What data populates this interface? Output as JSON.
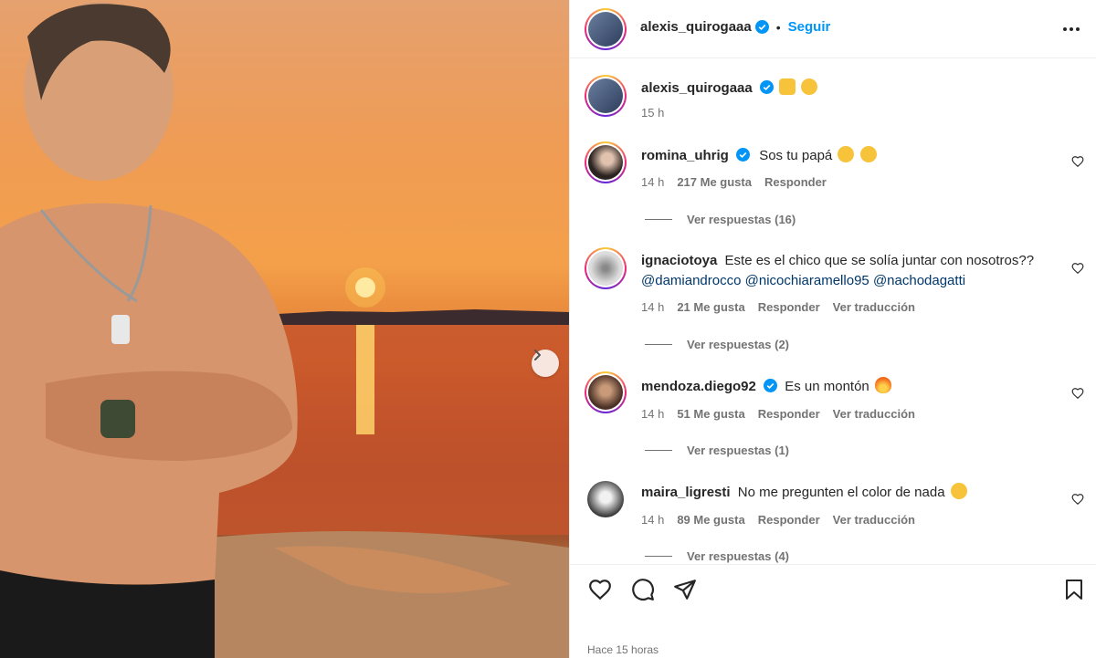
{
  "post": {
    "author": "alexis_quirogaaa",
    "follow_label": "Seguir",
    "caption_time": "15 h",
    "time_ago": "Hace 15 horas"
  },
  "comments": [
    {
      "user": "romina_uhrig",
      "verified": true,
      "text": "Sos tu papá",
      "time": "14 h",
      "likes": "217 Me gusta",
      "reply_label": "Responder",
      "translate_label": "",
      "replies": "Ver respuestas (16)"
    },
    {
      "user": "ignaciotoya",
      "verified": false,
      "text": "Este es el chico que se solía juntar con nosotros??",
      "mentions": [
        "@damiandrocco",
        "@nicochiaramello95",
        "@nachodagatti"
      ],
      "time": "14 h",
      "likes": "21 Me gusta",
      "reply_label": "Responder",
      "translate_label": "Ver traducción",
      "replies": "Ver respuestas (2)"
    },
    {
      "user": "mendoza.diego92",
      "verified": true,
      "text": "Es un montón",
      "time": "14 h",
      "likes": "51 Me gusta",
      "reply_label": "Responder",
      "translate_label": "Ver traducción",
      "replies": "Ver respuestas (1)"
    },
    {
      "user": "maira_ligresti",
      "verified": false,
      "text": "No me pregunten el color de nada",
      "time": "14 h",
      "likes": "89 Me gusta",
      "reply_label": "Responder",
      "translate_label": "Ver traducción",
      "replies": "Ver respuestas (4)"
    }
  ],
  "colors": {
    "accent": "#0095f6",
    "text": "#262626",
    "secondary": "#737373",
    "mention": "#00376b"
  },
  "icons": {
    "next": "chevron-right-icon",
    "more": "more-horizontal-icon",
    "verified": "verified-badge-icon",
    "like": "heart-icon",
    "comment": "comment-icon",
    "share": "paper-plane-icon",
    "save": "bookmark-icon"
  }
}
